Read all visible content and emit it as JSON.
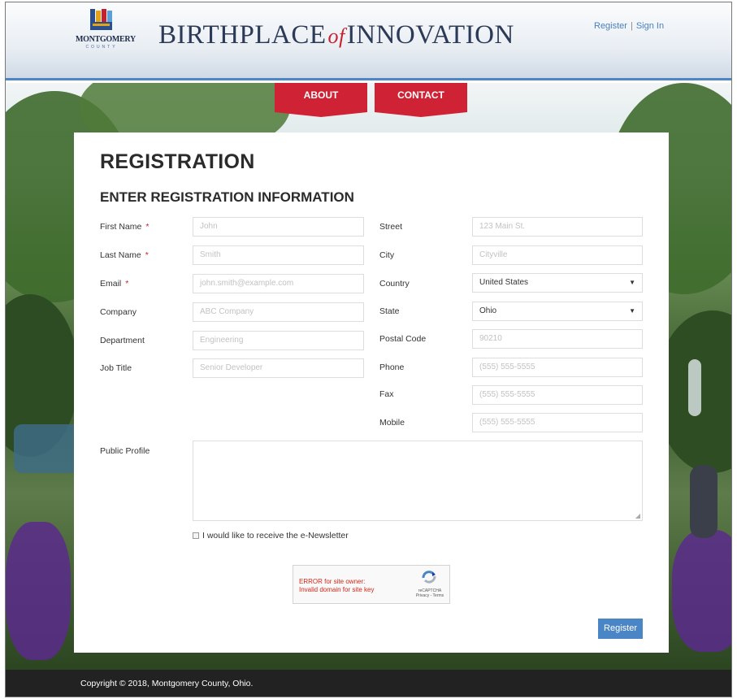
{
  "header": {
    "logo_word": "MONTGOMERY",
    "logo_sub": "COUNTY",
    "title_left": "BIRTHPLACE",
    "title_of": "of",
    "title_right": "INNOVATION",
    "register_link": "Register",
    "signin_link": "Sign In",
    "separator": "|"
  },
  "nav": {
    "about": "ABOUT",
    "contact": "CONTACT"
  },
  "form": {
    "heading": "REGISTRATION",
    "subheading": "ENTER REGISTRATION INFORMATION",
    "required_mark": "*",
    "left": [
      {
        "label": "First Name",
        "placeholder": "John"
      },
      {
        "label": "Last Name",
        "placeholder": "Smith"
      },
      {
        "label": "Email",
        "placeholder": "john.smith@example.com"
      },
      {
        "label": "Company",
        "placeholder": "ABC Company"
      },
      {
        "label": "Department",
        "placeholder": "Engineering"
      },
      {
        "label": "Job Title",
        "placeholder": "Senior Developer"
      }
    ],
    "right": [
      {
        "label": "Street",
        "placeholder": "123 Main St."
      },
      {
        "label": "City",
        "placeholder": "Cityville"
      },
      {
        "label": "Country",
        "value": "United States"
      },
      {
        "label": "State",
        "value": "Ohio"
      },
      {
        "label": "Postal Code",
        "placeholder": "90210"
      },
      {
        "label": "Phone",
        "placeholder": "(555) 555-5555"
      },
      {
        "label": "Fax",
        "placeholder": "(555) 555-5555"
      },
      {
        "label": "Mobile",
        "placeholder": "(555) 555-5555"
      }
    ],
    "public_profile_label": "Public Profile",
    "newsletter_label": "I would like to receive the e-Newsletter",
    "captcha_error": "ERROR for site owner:\nInvalid domain for site key",
    "captcha_brand": "reCAPTCHA",
    "captcha_links": "Privacy - Terms",
    "submit_label": "Register"
  },
  "footer": {
    "copyright": "Copyright © 2018, Montgomery County, Ohio."
  },
  "colors": {
    "brand_red": "#cf2234",
    "brand_blue": "#4a86c6",
    "footer_bg": "#222222"
  }
}
